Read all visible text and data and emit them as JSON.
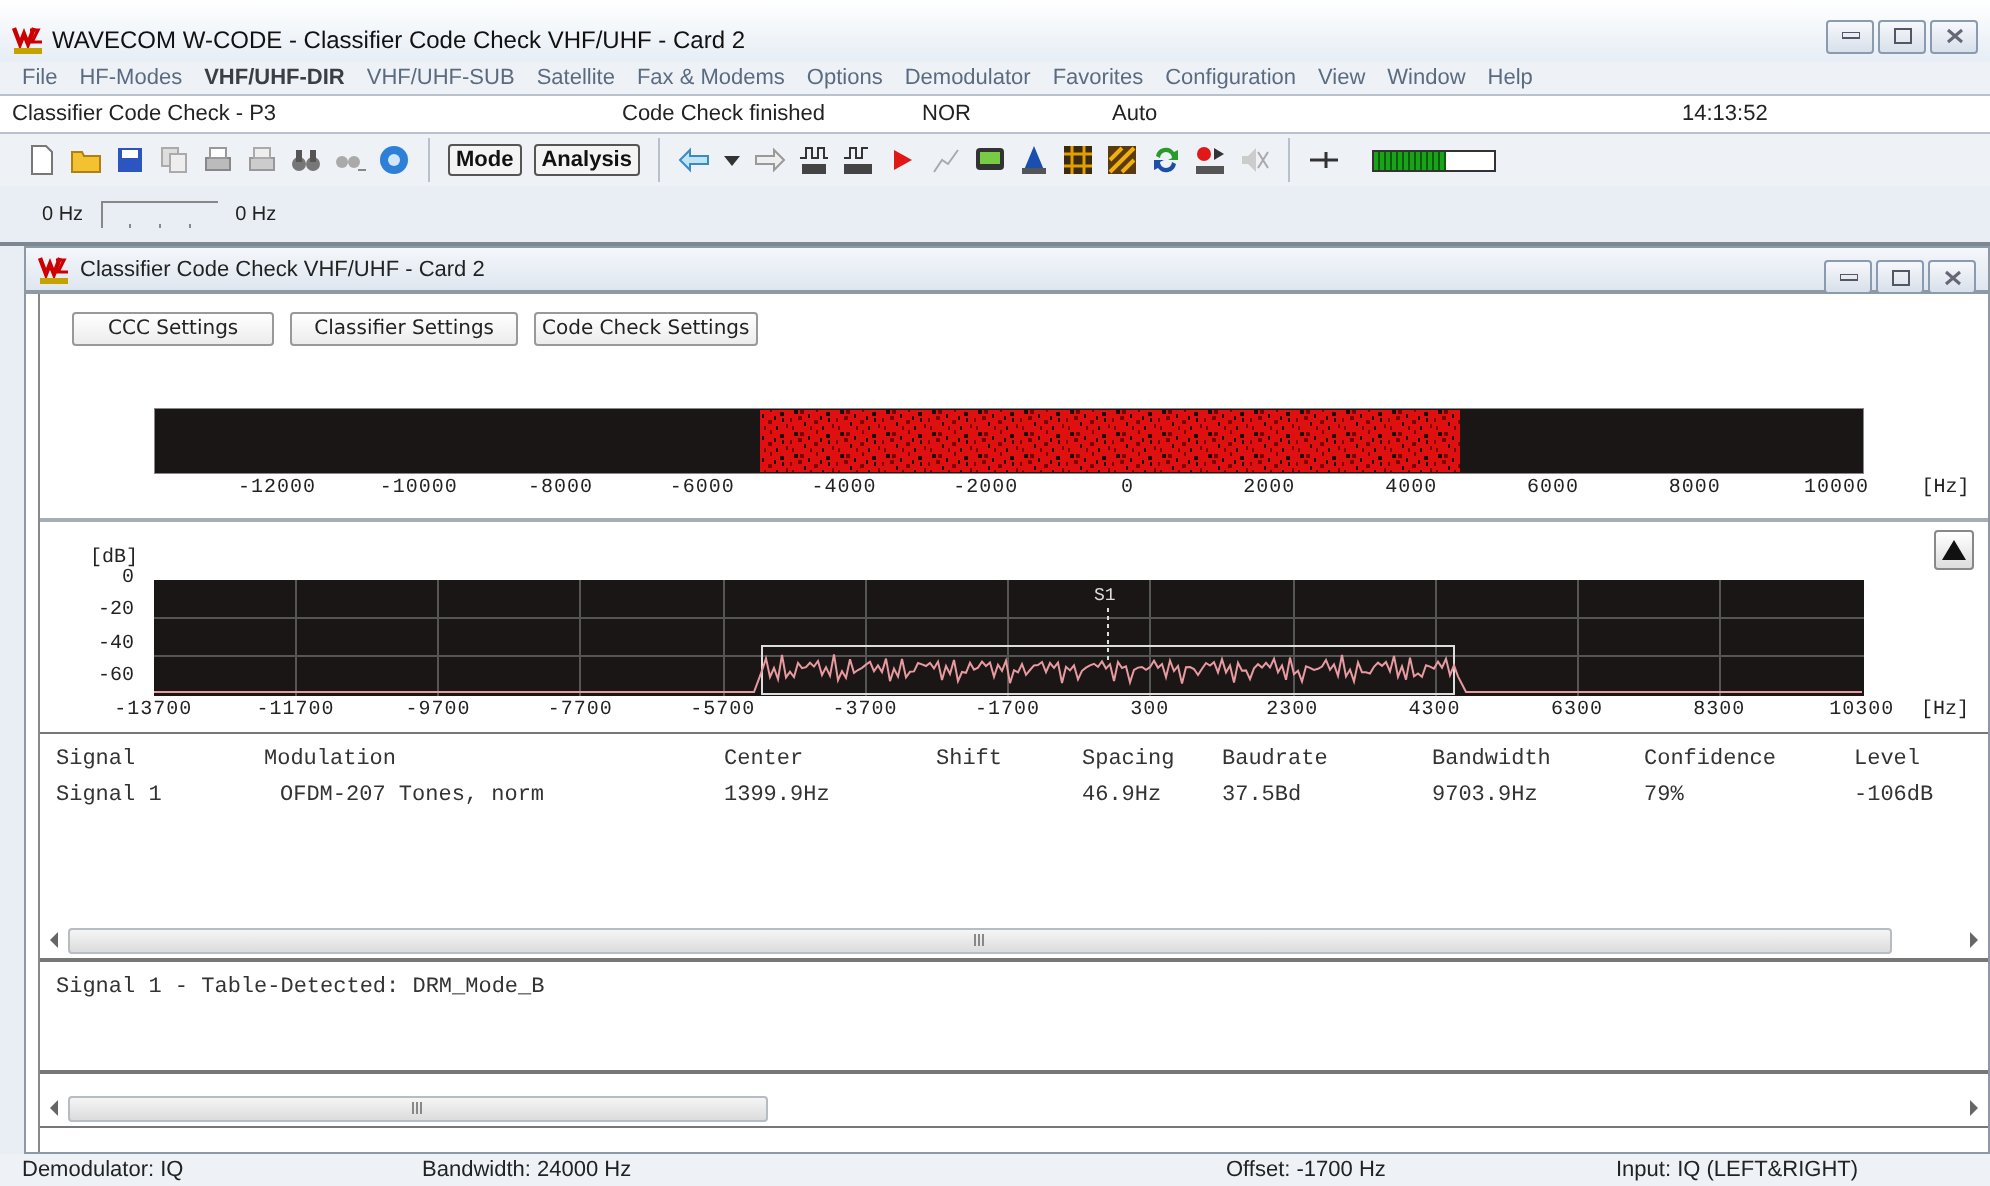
{
  "window": {
    "title": "WAVECOM W-CODE - Classifier Code Check VHF/UHF  - Card 2"
  },
  "menu": [
    {
      "label": "File",
      "selected": false
    },
    {
      "label": "HF-Modes",
      "selected": false
    },
    {
      "label": "VHF/UHF-DIR",
      "selected": true
    },
    {
      "label": "VHF/UHF-SUB",
      "selected": false
    },
    {
      "label": "Satellite",
      "selected": false
    },
    {
      "label": "Fax & Modems",
      "selected": false
    },
    {
      "label": "Options",
      "selected": false
    },
    {
      "label": "Demodulator",
      "selected": false
    },
    {
      "label": "Favorites",
      "selected": false
    },
    {
      "label": "Configuration",
      "selected": false
    },
    {
      "label": "View",
      "selected": false
    },
    {
      "label": "Window",
      "selected": false
    },
    {
      "label": "Help",
      "selected": false
    }
  ],
  "info_bar": [
    "Classifier Code Check - P3",
    "Code Check finished",
    "NOR",
    "Auto",
    "14:13:52"
  ],
  "toolbar": {
    "buttons": [
      "Mode",
      "Analysis"
    ],
    "signal_meter": {
      "level": 0.6
    }
  },
  "frequency_bar": {
    "left": "0 Hz",
    "right": "0 Hz"
  },
  "child_window": {
    "title": "Classifier Code Check VHF/UHF  - Card 2",
    "buttons": [
      "CCC Settings",
      "Classifier Settings",
      "Code Check Settings"
    ],
    "waterfall": {
      "x_ticks": [
        "-12000",
        "-10000",
        "-8000",
        "-6000",
        "-4000",
        "-2000",
        "0",
        "2000",
        "4000",
        "6000",
        "8000",
        "10000"
      ],
      "unit": "[Hz]"
    },
    "spectrum": {
      "y_label": "[dB]",
      "y_ticks": [
        "0",
        "-20",
        "-40",
        "-60"
      ],
      "x_ticks": [
        "-13700",
        "-11700",
        "-9700",
        "-7700",
        "-5700",
        "-3700",
        "-1700",
        "300",
        "2300",
        "4300",
        "6300",
        "8300",
        "10300"
      ],
      "unit": "[Hz]",
      "marker": "S1"
    },
    "table": {
      "columns": [
        "Signal",
        "Modulation",
        "Center",
        "Shift",
        "Spacing",
        "Baudrate",
        "Bandwidth",
        "Confidence",
        "Level"
      ],
      "rows": [
        [
          "Signal 1",
          "OFDM-207 Tones, norm",
          "1399.9Hz",
          "",
          "46.9Hz",
          "37.5Bd",
          "9703.9Hz",
          "79%",
          "-106dB"
        ]
      ]
    },
    "messages": [
      "Signal 1 - Table-Detected: DRM_Mode_B"
    ]
  },
  "status_bar": [
    "Demodulator: IQ",
    "Bandwidth: 24000 Hz",
    "Offset: -1700 Hz",
    "Input: IQ (LEFT&RIGHT)"
  ]
}
